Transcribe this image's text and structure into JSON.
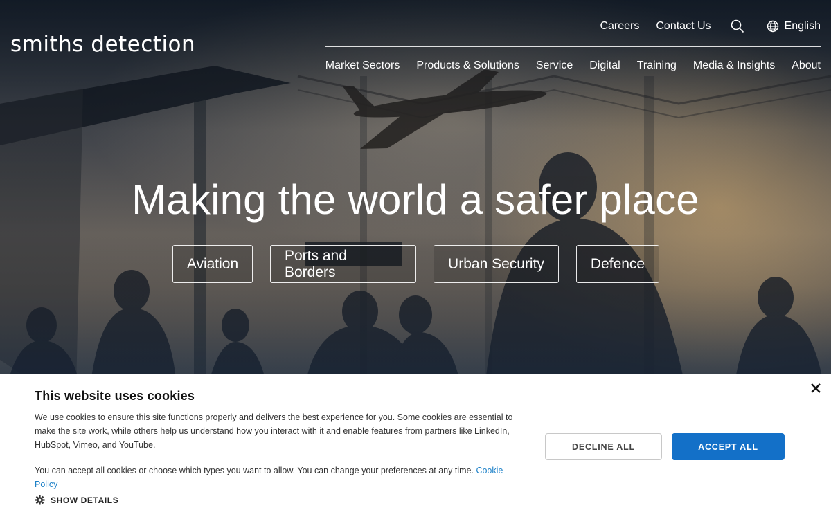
{
  "header": {
    "logo_text": "smiths detection",
    "utility_links": [
      "Careers",
      "Contact Us"
    ],
    "search_icon": "search-icon",
    "language": {
      "icon": "globe-icon",
      "label": "English"
    },
    "main_nav": [
      "Market Sectors",
      "Products & Solutions",
      "Service",
      "Digital",
      "Training",
      "Media & Insights",
      "About"
    ]
  },
  "hero": {
    "title": "Making the world a safer place",
    "sector_buttons": [
      "Aviation",
      "Ports and Borders",
      "Urban Security",
      "Defence"
    ]
  },
  "cookie_banner": {
    "title": "This website uses cookies",
    "paragraph1": "We use cookies to ensure this site functions properly and delivers the best experience for you. Some cookies are essential to make the site work, while others help us understand how you interact with it and enable features from partners like LinkedIn, HubSpot, Vimeo, and YouTube.",
    "paragraph2": "You can accept all cookies or choose which types you want to allow. You can change your preferences at any time.",
    "policy_link": "Cookie Policy",
    "show_details": "SHOW DETAILS",
    "show_details_icon": "gear-icon",
    "decline_label": "DECLINE ALL",
    "accept_label": "ACCEPT ALL",
    "close_icon": "close-icon",
    "accent_color": "#1370c8"
  }
}
